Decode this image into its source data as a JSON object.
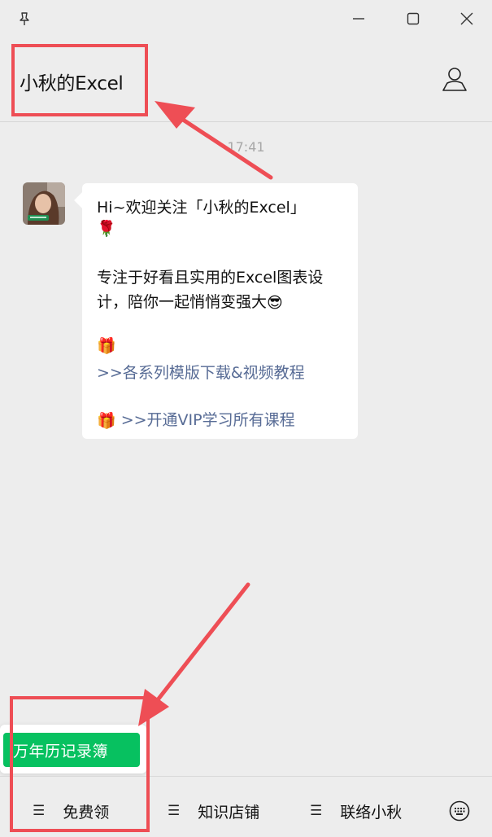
{
  "window": {
    "controls": [
      "pin-icon",
      "minimize-icon",
      "maximize-icon",
      "close-icon"
    ]
  },
  "header": {
    "title": "小秋的Excel",
    "profile_icon": "person-icon"
  },
  "chat": {
    "timestamp": "17:41",
    "message": {
      "line1": "Hi~欢迎关注「小秋的Excel」",
      "line2_emoji": "🌹",
      "line3": "专注于好看且实用的Excel图表设",
      "line4": "计，陪你一起悄悄变强大",
      "line4_emoji": "😎",
      "gift_emoji": "🎁",
      "link1": ">>各系列模版下载&视频教程",
      "link2": ">>开通VIP学习所有课程"
    }
  },
  "popup": {
    "item": "万年历记录簿"
  },
  "bottom_menu": {
    "items": [
      {
        "icon": "☰",
        "label": "免费领"
      },
      {
        "icon": "☰",
        "label": "知识店铺"
      },
      {
        "icon": "☰",
        "label": "联络小秋"
      }
    ],
    "keyboard_icon": "keyboard-icon"
  },
  "colors": {
    "background": "#ededed",
    "bubble": "#ffffff",
    "link": "#576b95",
    "accent_green": "#07c160",
    "annotation_red": "#ee4e55"
  }
}
